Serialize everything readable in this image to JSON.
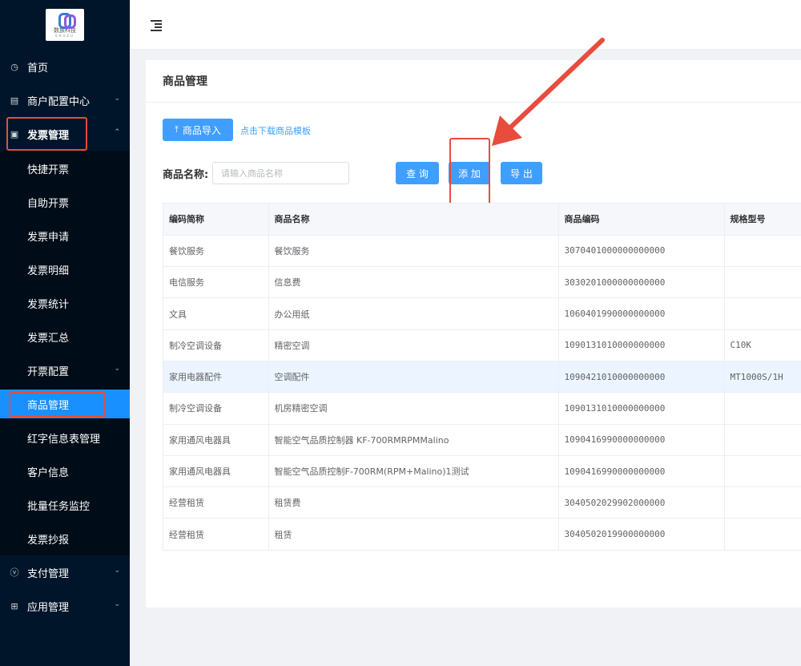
{
  "logo": {
    "text": "数族科技",
    "sub": "SHUZU"
  },
  "sidebar": {
    "items": [
      {
        "label": "首页",
        "icon": "dashboard-icon"
      },
      {
        "label": "商户配置中心",
        "icon": "store-config-icon"
      },
      {
        "label": "发票管理",
        "icon": "invoice-icon"
      },
      {
        "label": "支付管理",
        "icon": "payment-icon"
      },
      {
        "label": "应用管理",
        "icon": "apps-icon"
      }
    ],
    "sub_items": [
      {
        "label": "快捷开票"
      },
      {
        "label": "自助开票"
      },
      {
        "label": "发票申请"
      },
      {
        "label": "发票明细"
      },
      {
        "label": "发票统计"
      },
      {
        "label": "发票汇总"
      },
      {
        "label": "开票配置"
      },
      {
        "label": "商品管理"
      },
      {
        "label": "红字信息表管理"
      },
      {
        "label": "客户信息"
      },
      {
        "label": "批量任务监控"
      },
      {
        "label": "发票抄报"
      }
    ]
  },
  "page": {
    "title": "商品管理",
    "import_button": "商品导入",
    "download_link": "点击下载商品模板",
    "search": {
      "label": "商品名称:",
      "placeholder": "请输入商品名称"
    },
    "query_button": "查 询",
    "add_button": "添 加",
    "export_button": "导 出"
  },
  "table": {
    "headers": [
      "编码简称",
      "商品名称",
      "商品编码",
      "规格型号"
    ],
    "rows": [
      [
        "餐饮服务",
        "餐饮服务",
        "3070401000000000000",
        ""
      ],
      [
        "电信服务",
        "信息费",
        "3030201000000000000",
        ""
      ],
      [
        "文具",
        "办公用纸",
        "1060401990000000000",
        ""
      ],
      [
        "制冷空调设备",
        "精密空调",
        "1090131010000000000",
        "C10K"
      ],
      [
        "家用电器配件",
        "空调配件",
        "1090421010000000000",
        "MT1000S/1H"
      ],
      [
        "制冷空调设备",
        "机房精密空调",
        "1090131010000000000",
        ""
      ],
      [
        "家用通风电器具",
        "智能空气品质控制器 KF-700RMRPMMalino",
        "1090416990000000000",
        ""
      ],
      [
        "家用通风电器具",
        "智能空气品质控制F-700RM(RPM+Malino)1测试",
        "1090416990000000000",
        ""
      ],
      [
        "经营租赁",
        "租赁费",
        "3040502029902000000",
        ""
      ],
      [
        "经营租赁",
        "租赁",
        "3040502019900000000",
        ""
      ]
    ]
  },
  "colors": {
    "sidebar": "#001529",
    "primary": "#409eff",
    "annotation": "#e74c3c"
  }
}
